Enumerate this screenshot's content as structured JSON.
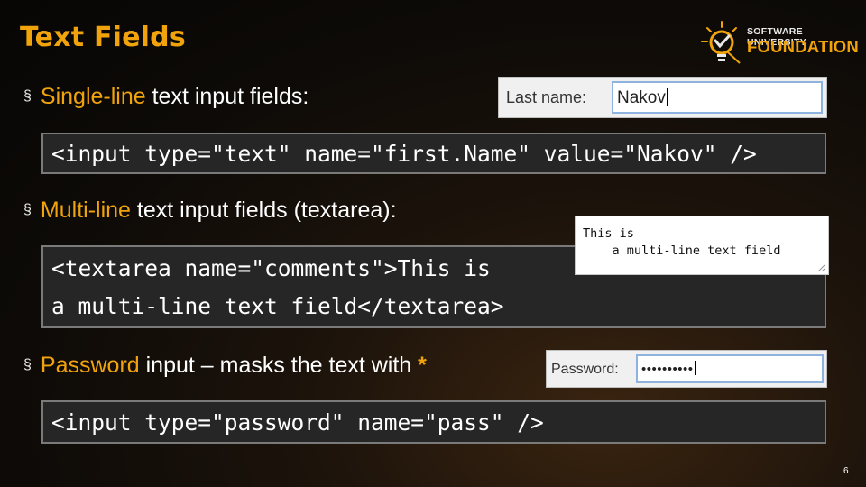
{
  "slide": {
    "title": "Text Fields",
    "page_number": "6"
  },
  "logo": {
    "line1": "SOFTWARE UNIVERSITY",
    "line2": "FOUNDATION",
    "accent_color": "#f0a30a"
  },
  "bullets": [
    {
      "marker": "§",
      "highlight": "Single-line",
      "rest": " text input fields:"
    },
    {
      "marker": "§",
      "highlight": "Multi-line",
      "rest": " text input fields (textarea):"
    },
    {
      "marker": "§",
      "highlight": "Password",
      "rest": " input – masks the text with ",
      "emphasis": "*"
    }
  ],
  "code": {
    "single_line": "<input type=\"text\" name=\"first.Name\" value=\"Nakov\" />",
    "textarea_line1": "<textarea name=\"comments\">This is",
    "textarea_line2": "a multi-line text field</textarea>",
    "password": "<input type=\"password\" name=\"pass\" />"
  },
  "demos": {
    "text": {
      "label": "Last name:",
      "value": "Nakov"
    },
    "textarea": {
      "line1": "This is",
      "line2": "    a multi-line text field"
    },
    "password": {
      "label": "Password:",
      "masked_value": "••••••••••"
    }
  }
}
